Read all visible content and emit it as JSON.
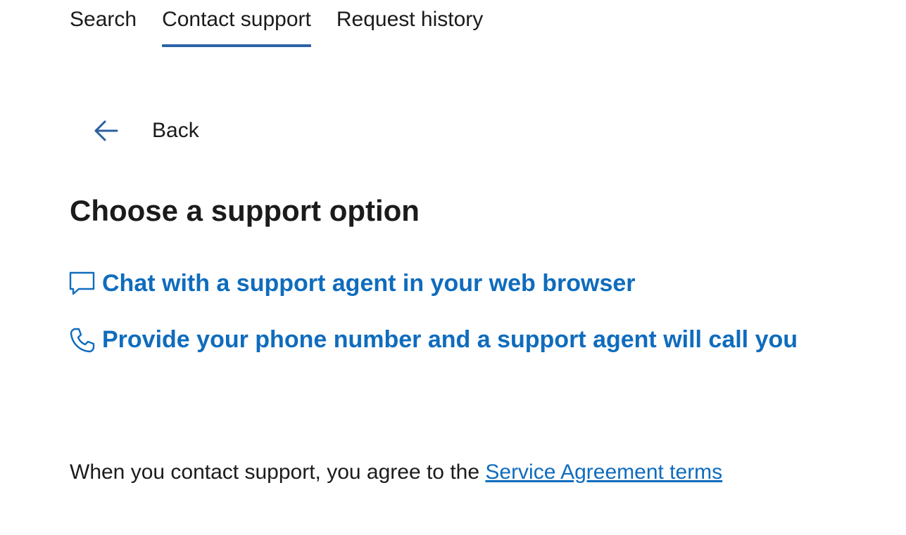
{
  "tabs": {
    "search": "Search",
    "contact": "Contact support",
    "history": "Request history"
  },
  "back": {
    "label": "Back",
    "icon": "arrow-left-icon"
  },
  "heading": "Choose a support option",
  "options": {
    "chat": {
      "icon": "chat-icon",
      "label": "Chat with a support agent in your web browser"
    },
    "phone": {
      "icon": "phone-icon",
      "label": "Provide your phone number and a support agent will call you"
    }
  },
  "footer": {
    "text": "When you contact support, you agree to the ",
    "link": "Service Agreement terms"
  },
  "colors": {
    "accent": "#0f6cbd",
    "tab_underline": "#2b63a6",
    "text": "#1b1b1b"
  }
}
